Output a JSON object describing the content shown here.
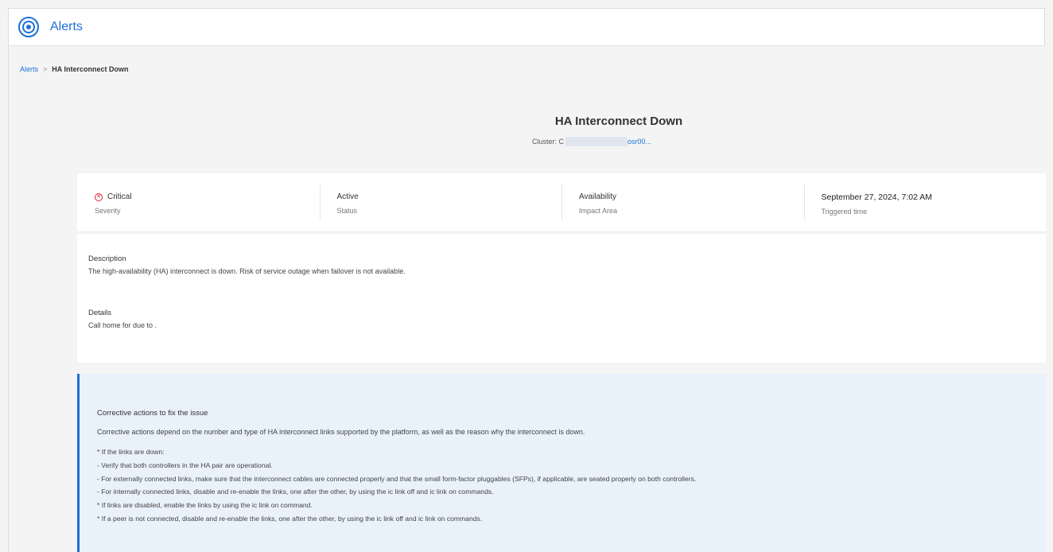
{
  "header": {
    "title": "Alerts",
    "logo_icon": "alert-logo-icon"
  },
  "breadcrumb": {
    "parent": "Alerts",
    "separator": ">",
    "current": "HA Interconnect Down"
  },
  "alert": {
    "title": "HA Interconnect Down",
    "cluster_label": "Cluster: C",
    "cluster_suffix": "osr00..."
  },
  "summary": [
    {
      "value": "Critical",
      "label": "Severity",
      "icon": "critical-icon"
    },
    {
      "value": "Active",
      "label": "Status"
    },
    {
      "value": "Availability",
      "label": "Impact Area"
    },
    {
      "value": "September 27, 2024, 7:02 AM",
      "label": "Triggered time"
    }
  ],
  "description": {
    "heading": "Description",
    "text": "The high-availability (HA) interconnect is down. Risk of service outage when failover is not available."
  },
  "details": {
    "heading": "Details",
    "text": "Call home for due to ."
  },
  "corrective": {
    "heading": "Corrective actions to fix the issue",
    "intro": "Corrective actions depend on the number and type of HA interconnect links supported by the platform, as well as the reason why the interconnect is down.",
    "steps": [
      "* If the links are down:",
      "- Verify that both controllers in the HA pair are operational.",
      "- For externally connected links, make sure that the interconnect cables are connected properly and that the small form-factor pluggables (SFPs), if applicable, are seated properly on both controllers.",
      "- For internally connected links, disable and re-enable the links, one after the other, by using the ic link off and ic link on commands.",
      "* If links are disabled, enable the links by using the ic link on command.",
      "* If a peer is not connected, disable and re-enable the links, one after the other, by using the ic link off and ic link on commands."
    ]
  },
  "colors": {
    "accent": "#1d6fd6",
    "critical": "#d9232e",
    "callout_bg": "#e9f1fb"
  }
}
